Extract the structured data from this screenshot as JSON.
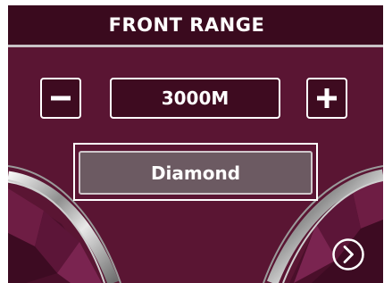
{
  "header": {
    "title": "FRONT RANGE"
  },
  "range": {
    "value": "3000M"
  },
  "surface": {
    "selected": "Diamond"
  },
  "icons": {
    "decrease": "minus-icon",
    "increase": "plus-icon",
    "next": "chevron-right-circle-icon"
  },
  "colors": {
    "background": "#5a1533",
    "header_background": "#3a0a1e",
    "control_background": "#3e0b20",
    "selected_background": "#6c5a62",
    "text": "#ffffff"
  }
}
